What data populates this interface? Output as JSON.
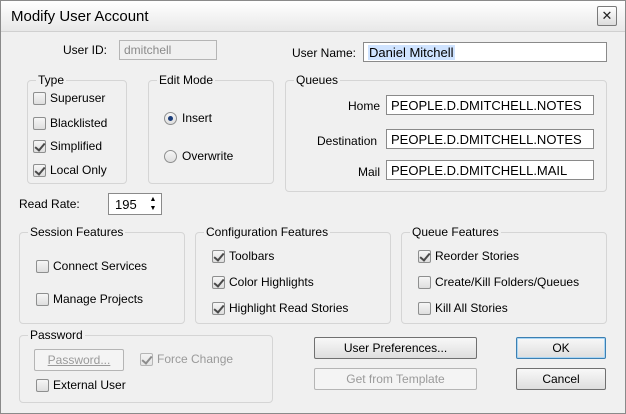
{
  "window": {
    "title": "Modify User Account",
    "close_glyph": "✕"
  },
  "user": {
    "id_label": "User ID:",
    "id_value": "dmitchell",
    "name_label": "User Name:",
    "name_value": "Daniel Mitchell"
  },
  "type_group": {
    "title": "Type",
    "items": [
      {
        "label": "Superuser",
        "checked": false
      },
      {
        "label": "Blacklisted",
        "checked": false
      },
      {
        "label": "Simplified",
        "checked": true
      },
      {
        "label": "Local Only",
        "checked": true
      }
    ]
  },
  "edit_mode": {
    "title": "Edit Mode",
    "options": [
      {
        "label": "Insert",
        "selected": true
      },
      {
        "label": "Overwrite",
        "selected": false
      }
    ]
  },
  "queues": {
    "title": "Queues",
    "home_label": "Home",
    "home_value": "PEOPLE.D.DMITCHELL.NOTES",
    "destination_label": "Destination",
    "destination_value": "PEOPLE.D.DMITCHELL.NOTES",
    "mail_label": "Mail",
    "mail_value": "PEOPLE.D.DMITCHELL.MAIL"
  },
  "read_rate": {
    "label": "Read Rate:",
    "value": "195"
  },
  "session_features": {
    "title": "Session Features",
    "items": [
      {
        "label": "Connect Services",
        "checked": false
      },
      {
        "label": "Manage Projects",
        "checked": false
      }
    ]
  },
  "config_features": {
    "title": "Configuration Features",
    "items": [
      {
        "label": "Toolbars",
        "checked": true
      },
      {
        "label": "Color Highlights",
        "checked": true
      },
      {
        "label": "Highlight Read Stories",
        "checked": true
      }
    ]
  },
  "queue_features": {
    "title": "Queue Features",
    "items": [
      {
        "label": "Reorder Stories",
        "checked": true
      },
      {
        "label": "Create/Kill Folders/Queues",
        "checked": false
      },
      {
        "label": "Kill All Stories",
        "checked": false
      }
    ]
  },
  "password": {
    "title": "Password",
    "button_label": "Password...",
    "force_change_label": "Force Change",
    "force_change_checked": true,
    "external_user_label": "External User",
    "external_user_checked": false
  },
  "buttons": {
    "user_preferences": "User Preferences...",
    "get_from_template": "Get from Template",
    "ok": "OK",
    "cancel": "Cancel"
  }
}
